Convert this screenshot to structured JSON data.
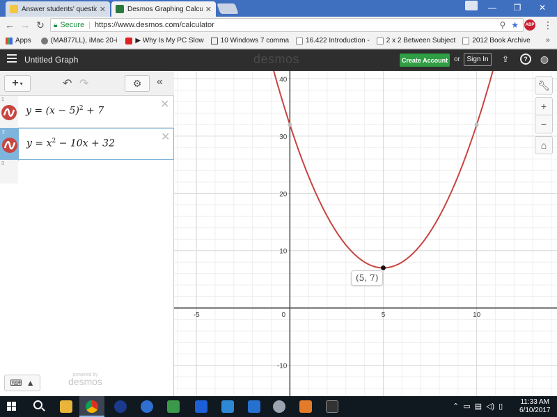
{
  "browser": {
    "tabs": [
      {
        "label": "Answer students' questio",
        "favicon": "yahoo-answers",
        "color": "#6b2bb7"
      },
      {
        "label": "Desmos Graphing Calcula",
        "favicon": "desmos",
        "color": "#2b7a3d"
      }
    ],
    "address": {
      "secure_label": "Secure",
      "url": "https://www.desmos.com/calculator"
    },
    "bookmarks": [
      {
        "label": "Apps"
      },
      {
        "label": "(MA877LL), iMac 20-i"
      },
      {
        "label": "▶ Why Is My PC Slow"
      },
      {
        "label": "10 Windows 7 comma"
      },
      {
        "label": "16.422 Introduction -"
      },
      {
        "label": "2 x 2 Between Subject"
      },
      {
        "label": "2012 Book Archive"
      }
    ],
    "extension_badge": "ABP"
  },
  "desmos": {
    "graph_title": "Untitled Graph",
    "logo": "desmos",
    "create_account": "Create Account",
    "or_text": "or",
    "sign_in": "Sign In",
    "powered_by": "powered by",
    "powered_logo": "desmos",
    "expressions": [
      {
        "index": "1",
        "lhs": "y",
        "eq": "=",
        "body_a": "(x − 5)",
        "exp_a": "2",
        "body_b": " + 7"
      },
      {
        "index": "2",
        "lhs": "y",
        "eq": "=",
        "body_a": "x",
        "exp_a": "2",
        "body_b": " − 10x + 32"
      },
      {
        "index": "3"
      }
    ],
    "point_label": "(5, 7)",
    "curve_color": "#c74440"
  },
  "chart_data": {
    "type": "line",
    "title": "",
    "xlabel": "",
    "ylabel": "",
    "xlim": [
      -6.2,
      14.3
    ],
    "ylim": [
      -15.4,
      41.4
    ],
    "x_ticks": [
      -5,
      0,
      5,
      10
    ],
    "y_ticks": [
      -10,
      10,
      20,
      30,
      40
    ],
    "grid": true,
    "series": [
      {
        "name": "",
        "function": "(x-5)^2+7",
        "color": "#c74440"
      }
    ],
    "points": [
      {
        "x": 5,
        "y": 7,
        "label": "(5, 7)",
        "color": "#111111"
      },
      {
        "x": 0,
        "y": 32,
        "label": "",
        "color": "#bdbdbd"
      },
      {
        "x": 10,
        "y": 32,
        "label": "",
        "color": "#bdbdbd"
      }
    ]
  },
  "taskbar": {
    "time": "11:33 AM",
    "date": "6/10/2017"
  }
}
